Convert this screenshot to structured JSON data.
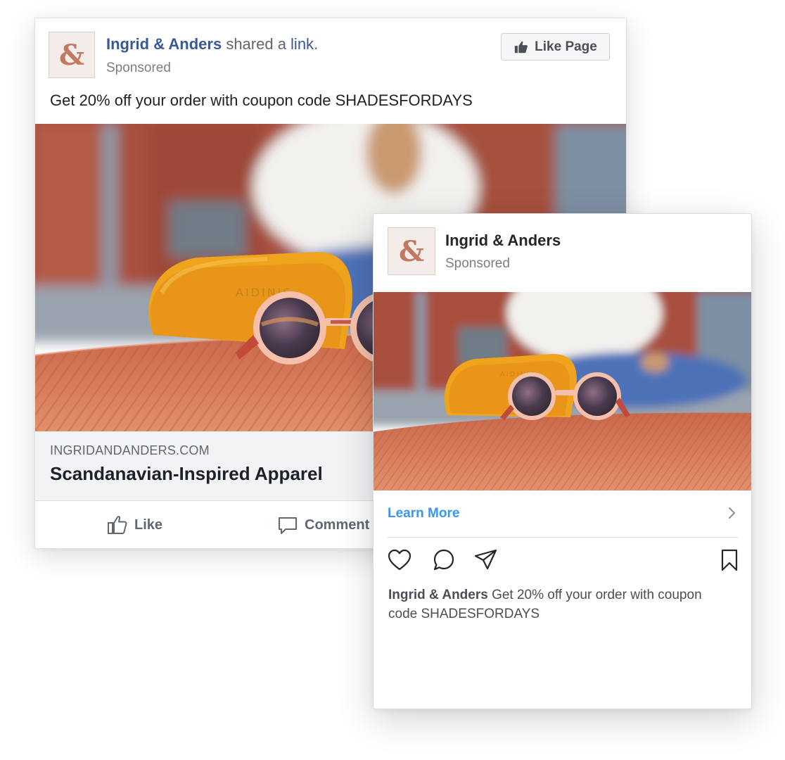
{
  "facebook_ad": {
    "page_name": "Ingrid & Anders",
    "action_text": " shared a ",
    "link_text": "link",
    "period": ".",
    "sponsored_label": "Sponsored",
    "like_page_label": "Like Page",
    "message": "Get 20% off your order with coupon code SHADESFORDAYS",
    "link_domain": "INGRIDANDANDERS.COM",
    "link_headline": "Scandanavian-Inspired Apparel",
    "like_label": "Like",
    "comment_label": "Comment"
  },
  "instagram_ad": {
    "account_name": "Ingrid & Anders",
    "sponsored_label": "Sponsored",
    "cta_label": "Learn More",
    "caption_name": "Ingrid & Anders",
    "caption_text": " Get 20% off your order with coupon code SHADESFORDAYS"
  },
  "brand": {
    "logo_icon": "ampersand-logo-icon",
    "logo_color": "#c07a62",
    "fb_link_color": "#385898",
    "ig_link_color": "#3897f0"
  }
}
